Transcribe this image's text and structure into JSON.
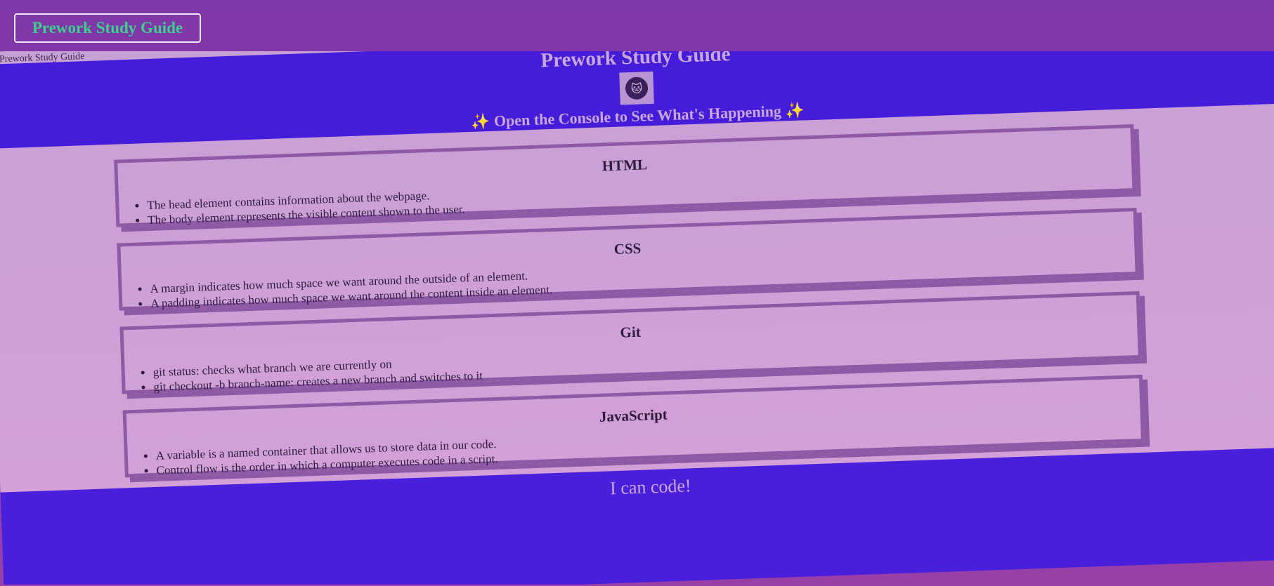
{
  "top_button": {
    "label": "Prework Study Guide"
  },
  "tab_label": "Prework Study Guide",
  "header": {
    "title": "Prework Study Guide",
    "logo_icon": "cat-icon",
    "subtitle": "Open the Console to See What's Happening",
    "sparkle": "✨"
  },
  "sections": [
    {
      "title": "HTML",
      "items": [
        "The head element contains information about the webpage.",
        "The body element represents the visible content shown to the user."
      ]
    },
    {
      "title": "CSS",
      "items": [
        "A margin indicates how much space we want around the outside of an element.",
        "A padding indicates how much space we want around the content inside an element."
      ]
    },
    {
      "title": "Git",
      "items": [
        "git status: checks what branch we are currently on",
        "git checkout -b branch-name: creates a new branch and switches to it"
      ]
    },
    {
      "title": "JavaScript",
      "items": [
        "A variable is a named container that allows us to store data in our code.",
        "Control flow is the order in which a computer executes code in a script."
      ]
    }
  ],
  "footer": {
    "text": "I can code!"
  },
  "colors": {
    "page_background": "#8239a8",
    "header_background": "#441cda",
    "content_background": "#c7a0d6",
    "card_border": "#8e5aa6",
    "button_text": "#3ecf8e"
  }
}
